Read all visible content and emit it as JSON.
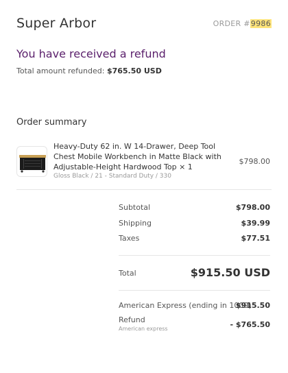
{
  "header": {
    "shop_name": "Super Arbor",
    "order_prefix": "ORDER #",
    "order_number": "9986"
  },
  "refund": {
    "title": "You have received a refund",
    "total_label": "Total amount refunded:",
    "total_value": "$765.50 USD"
  },
  "summary": {
    "heading": "Order summary",
    "item": {
      "title": "Heavy-Duty 62 in. W 14-Drawer, Deep Tool Chest Mobile Workbench in Matte Black with Adjustable-Height Hardwood Top × 1",
      "variant": "Gloss Black / 21 - Standard Duty / 330",
      "price": "$798.00"
    },
    "subtotal_label": "Subtotal",
    "subtotal_value": "$798.00",
    "shipping_label": "Shipping",
    "shipping_value": "$39.99",
    "taxes_label": "Taxes",
    "taxes_value": "$77.51",
    "total_label": "Total",
    "total_value": "$915.50 USD",
    "payment_label": "American Express (ending in 1009)",
    "payment_value": "$915.50",
    "refund_label": "Refund",
    "refund_method": "American express",
    "refund_value": "- $765.50"
  },
  "colors": {
    "accent": "#5a1f6b",
    "highlight": "#ffe47a"
  }
}
